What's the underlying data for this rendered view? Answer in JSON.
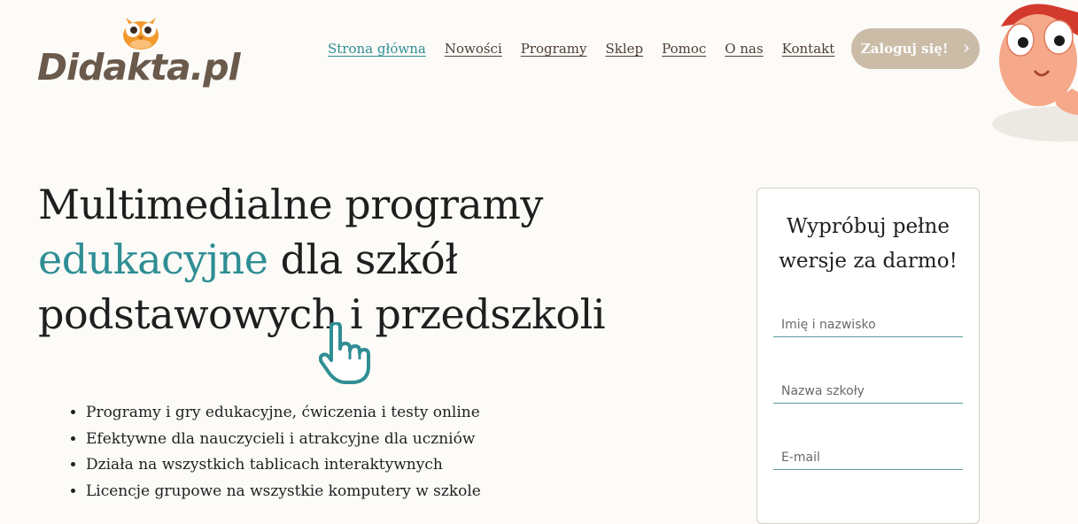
{
  "brand": {
    "logo_text": "Didakta.pl"
  },
  "nav": {
    "items": [
      {
        "label": "Strona główna"
      },
      {
        "label": "Nowości"
      },
      {
        "label": "Programy"
      },
      {
        "label": "Sklep"
      },
      {
        "label": "Pomoc"
      },
      {
        "label": "O nas"
      },
      {
        "label": "Kontakt"
      }
    ],
    "login_label": "Zaloguj się!",
    "login_chevron": "›"
  },
  "hero": {
    "line1": "Multimedialne programy",
    "accent_word": "edukacyjne",
    "line2_rest": " dla szkół",
    "line3": "podstawowych i przedszkoli"
  },
  "features": [
    "Programy i gry edukacyjne, ćwiczenia i testy online",
    "Efektywne dla nauczycieli i atrakcyjne dla uczniów",
    "Działa na wszystkich tablicach interaktywnych",
    "Licencje grupowe na wszystkie komputery w szkole"
  ],
  "signup": {
    "title_line1": "Wypróbuj pełne",
    "title_line2": "wersje za darmo!",
    "name_placeholder": "Imię i nazwisko",
    "school_placeholder": "Nazwa szkoły",
    "email_placeholder": "E-mail"
  },
  "colors": {
    "accent": "#2f8e94",
    "nav_text": "#4e3e33",
    "login_button": "#cbbca8",
    "logo_orange": "#f29a2e",
    "logo_brown": "#6a5a4c",
    "background": "#fcfbf8"
  },
  "icons": [
    "owl-logo-icon",
    "pointing-hand-icon",
    "chevron-right-icon",
    "mascot-character"
  ]
}
